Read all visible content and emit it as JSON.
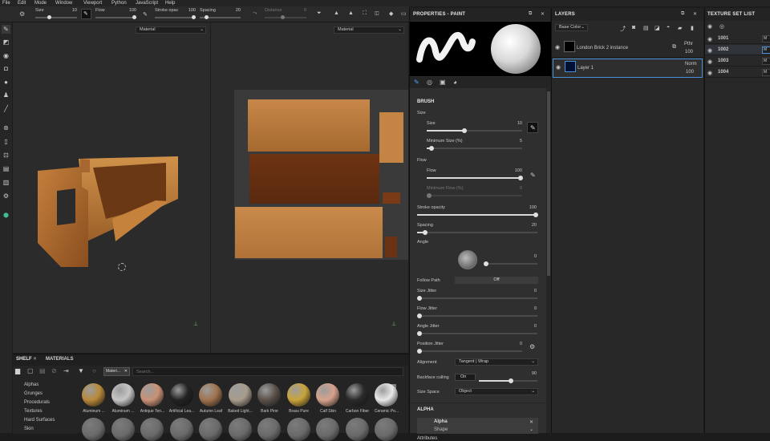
{
  "menubar": [
    "File",
    "Edit",
    "Mode",
    "Window",
    "Viewport",
    "Python",
    "JavaScript",
    "Help"
  ],
  "toolbar": {
    "size_label": "Size",
    "size_value": "10",
    "flow_label": "Flow",
    "flow_value": "100",
    "opacity_label": "Stroke opac",
    "opacity_value": "100",
    "spacing_label": "Spacing",
    "spacing_value": "20",
    "distance_label": "Distance",
    "distance_value": "0"
  },
  "viewport": {
    "left_material": "Material",
    "right_material": "Material"
  },
  "properties": {
    "title": "PROPERTIES - PAINT",
    "brush_header": "BRUSH",
    "size_group": "Size",
    "size_label": "Size",
    "size_value": "10",
    "min_size_label": "Minimum Size (%)",
    "min_size_value": "5",
    "flow_group": "Flow",
    "flow_label": "Flow",
    "flow_value": "100",
    "min_flow_label": "Minimum Flow (%)",
    "min_flow_value": "0",
    "stroke_opacity_label": "Stroke opacity",
    "stroke_opacity_value": "100",
    "spacing_label": "Spacing",
    "spacing_value": "20",
    "angle_label": "Angle",
    "angle_value": "0",
    "follow_path_label": "Follow Path",
    "follow_path_value": "Off",
    "size_jitter_label": "Size Jitter",
    "size_jitter_value": "0",
    "flow_jitter_label": "Flow Jitter",
    "flow_jitter_value": "0",
    "angle_jitter_label": "Angle Jitter",
    "angle_jitter_value": "0",
    "position_jitter_label": "Position Jitter",
    "position_jitter_value": "0",
    "alignment_label": "Alignment",
    "alignment_value": "Tangent | Wrap",
    "backface_label": "Backface culling",
    "backface_toggle": "On",
    "backface_value": "90",
    "size_space_label": "Size Space",
    "size_space_value": "Object",
    "alpha_header": "ALPHA",
    "alpha_name": "Alpha",
    "alpha_sub": "Shape",
    "attributes_label": "Attributes"
  },
  "layers": {
    "title": "LAYERS",
    "channel": "Base Color",
    "items": [
      {
        "name": "London Brick 2 instance",
        "blend": "Pthr",
        "opacity": "100"
      },
      {
        "name": "Layer 1",
        "blend": "Norm",
        "opacity": "100"
      }
    ]
  },
  "texture_set_list": {
    "title": "TEXTURE SET LIST",
    "items": [
      {
        "name": "1001",
        "mat": "M"
      },
      {
        "name": "1002",
        "mat": "M"
      },
      {
        "name": "1003",
        "mat": "M"
      },
      {
        "name": "1004",
        "mat": "M"
      }
    ]
  },
  "shelf": {
    "tabs": [
      "SHELF",
      "MATERIALS"
    ],
    "filter_chip": "Materi...",
    "search_placeholder": "Search...",
    "categories": [
      "Alphas",
      "Grunges",
      "Procedurals",
      "Textures",
      "Hard Surfaces",
      "Skin"
    ],
    "materials": [
      {
        "label": "Aluminum ...",
        "color": "#b8893a"
      },
      {
        "label": "Aluminum ...",
        "color": "#c6c6c6"
      },
      {
        "label": "Antique Ten...",
        "color": "#c99276"
      },
      {
        "label": "Artificial Lea...",
        "color": "#222222"
      },
      {
        "label": "Autumn Leaf",
        "color": "#a0734e"
      },
      {
        "label": "Baked Light...",
        "color": "#a89c8c"
      },
      {
        "label": "Bark Pine",
        "color": "#5a5049"
      },
      {
        "label": "Brass Pure",
        "color": "#c9a43a"
      },
      {
        "label": "Calf Skin",
        "color": "#d6a28c"
      },
      {
        "label": "Carbon Fiber",
        "color": "#2a2a2a"
      },
      {
        "label": "Ceramic Po...",
        "color": "#e8e8e8"
      }
    ]
  }
}
